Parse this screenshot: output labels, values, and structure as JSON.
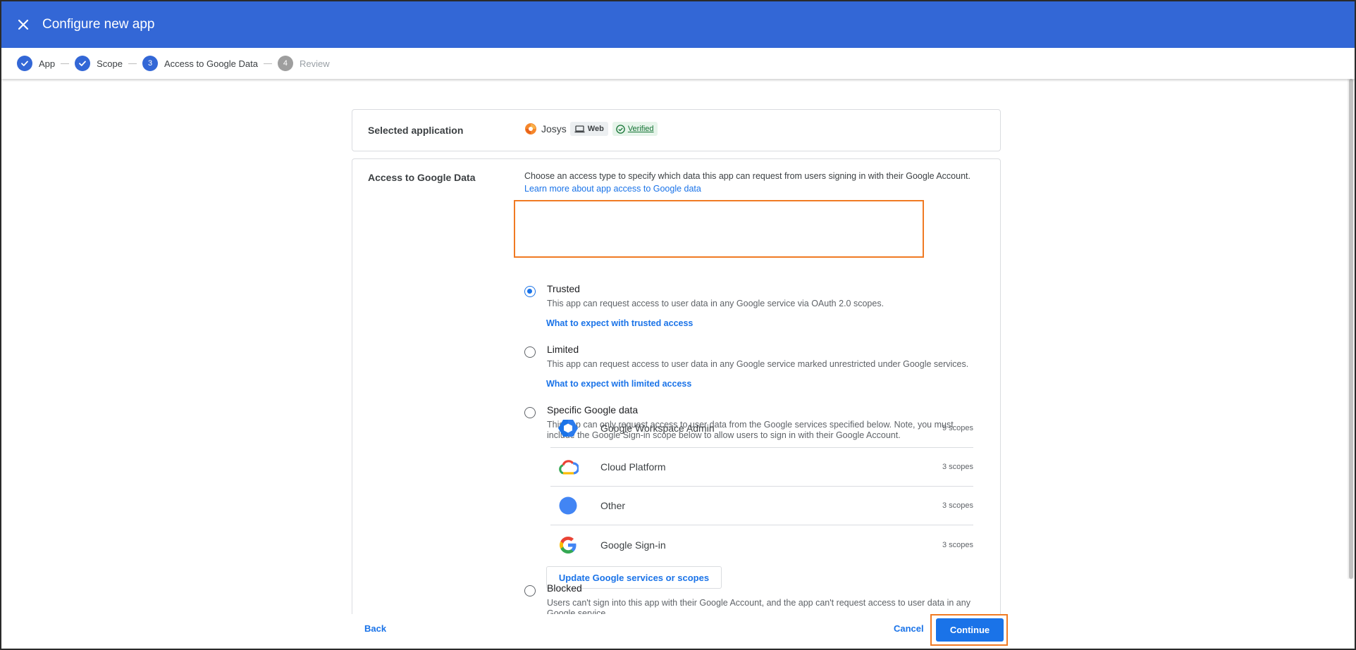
{
  "header": {
    "title": "Configure new app"
  },
  "stepper": {
    "steps": [
      {
        "number": "",
        "label": "App"
      },
      {
        "number": "",
        "label": "Scope"
      },
      {
        "number": "3",
        "label": "Access to Google Data"
      },
      {
        "number": "4",
        "label": "Review"
      }
    ]
  },
  "selected_app": {
    "label": "Selected application",
    "name": "Josys",
    "platform": "Web",
    "status": "Verified"
  },
  "access": {
    "label": "Access to Google Data",
    "intro": "Choose an access type to specify which data this app can request from users signing in with their Google Account.",
    "learn_more": "Learn more about app access to Google data",
    "options": {
      "trusted": {
        "title": "Trusted",
        "description": "This app can request access to user data in any Google service via OAuth 2.0 scopes.",
        "link": "What to expect with trusted access",
        "selected": true
      },
      "limited": {
        "title": "Limited",
        "description": "This app can request access to user data in any Google service marked unrestricted under Google services.",
        "link": "What to expect with limited access",
        "selected": false
      },
      "specific": {
        "title": "Specific Google data",
        "description": "This app can only request access to user data from the Google services specified below. Note, you must include the Google Sign-in scope below to allow users to sign in with their Google Account.",
        "selected": false
      },
      "blocked": {
        "title": "Blocked",
        "description": "Users can't sign into this app with their Google Account, and the app can't request access to user data in any Google service.",
        "selected": false
      }
    },
    "services": [
      {
        "name": "Google Workspace Admin",
        "count": "9 scopes",
        "icon": "workspace-admin-icon"
      },
      {
        "name": "Cloud Platform",
        "count": "3 scopes",
        "icon": "cloud-platform-icon"
      },
      {
        "name": "Other",
        "count": "3 scopes",
        "icon": "other-service-icon"
      },
      {
        "name": "Google Sign-in",
        "count": "3 scopes",
        "icon": "google-g-icon"
      }
    ],
    "update_button": "Update Google services or scopes"
  },
  "footer": {
    "back": "Back",
    "cancel": "Cancel",
    "continue": "Continue"
  },
  "colors": {
    "header_bg": "#3367d6",
    "link": "#1a73e8",
    "highlight": "#f07a23",
    "verified_green": "#137333"
  }
}
